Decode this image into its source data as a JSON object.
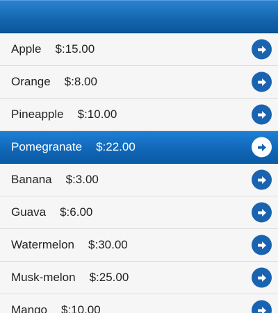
{
  "header": {
    "title": ""
  },
  "items": [
    {
      "name": "Apple",
      "price": "$:15.00"
    },
    {
      "name": "Orange",
      "price": "$:8.00"
    },
    {
      "name": "Pineapple",
      "price": "$:10.00"
    },
    {
      "name": "Pomegranate",
      "price": "$:22.00"
    },
    {
      "name": "Banana",
      "price": "$:3.00"
    },
    {
      "name": "Guava",
      "price": "$:6.00"
    },
    {
      "name": "Watermelon",
      "price": "$:30.00"
    },
    {
      "name": "Musk-melon",
      "price": "$:25.00"
    },
    {
      "name": "Mango",
      "price": "$:10.00"
    }
  ],
  "active_index": 3,
  "icons": {
    "row_arrow": "arrow-right-circle-icon"
  },
  "colors": {
    "header": "#1465ad",
    "active_row": "#0f66b6",
    "arrow_circle": "#1a63b0"
  }
}
